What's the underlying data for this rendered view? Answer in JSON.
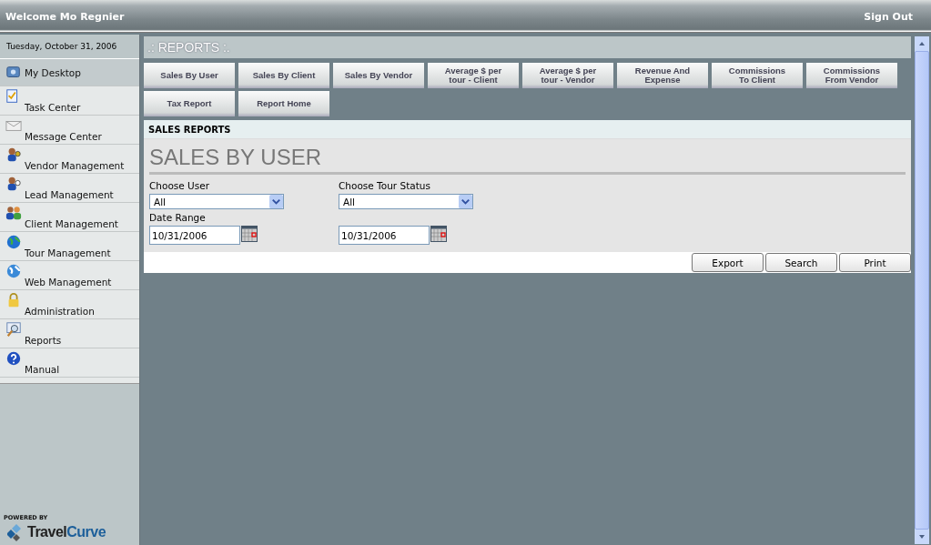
{
  "header": {
    "welcome": "Welcome Mo Regnier",
    "sign_out": "Sign Out"
  },
  "sidebar": {
    "date": "Tuesday, October 31, 2006",
    "items": [
      {
        "label": "My Desktop",
        "selected": true
      },
      {
        "label": "Task Center",
        "selected": false
      },
      {
        "label": "Message Center",
        "selected": false
      },
      {
        "label": "Vendor Management",
        "selected": false
      },
      {
        "label": "Lead Management",
        "selected": false
      },
      {
        "label": "Client Management",
        "selected": false
      },
      {
        "label": "Tour Management",
        "selected": false
      },
      {
        "label": "Web Management",
        "selected": false
      },
      {
        "label": "Administration",
        "selected": false
      },
      {
        "label": "Reports",
        "selected": false
      },
      {
        "label": "Manual",
        "selected": false
      }
    ],
    "powered_by": "POWERED BY",
    "brand_first": "Travel",
    "brand_second": "Curve"
  },
  "section_title": ".: REPORTS :.",
  "report_tabs": [
    [
      "Sales By User"
    ],
    [
      "Sales By Client"
    ],
    [
      "Sales By Vendor"
    ],
    [
      "Average $ per",
      "tour - Client"
    ],
    [
      "Average $ per",
      "tour - Vendor"
    ],
    [
      "Revenue And",
      "Expense"
    ],
    [
      "Commissions",
      "To Client"
    ],
    [
      "Commissions",
      "From Vendor"
    ],
    [
      "Tax Report"
    ],
    [
      "Report Home"
    ]
  ],
  "panel": {
    "heading": "SALES REPORTS",
    "title": "SALES BY USER",
    "user": {
      "label": "Choose User",
      "value": "All"
    },
    "tour_status": {
      "label": "Choose Tour Status",
      "value": "All"
    },
    "date_range": {
      "label": "Date Range",
      "from": "10/31/2006",
      "to": "10/31/2006"
    },
    "buttons": [
      "Export",
      "Search",
      "Print"
    ]
  }
}
